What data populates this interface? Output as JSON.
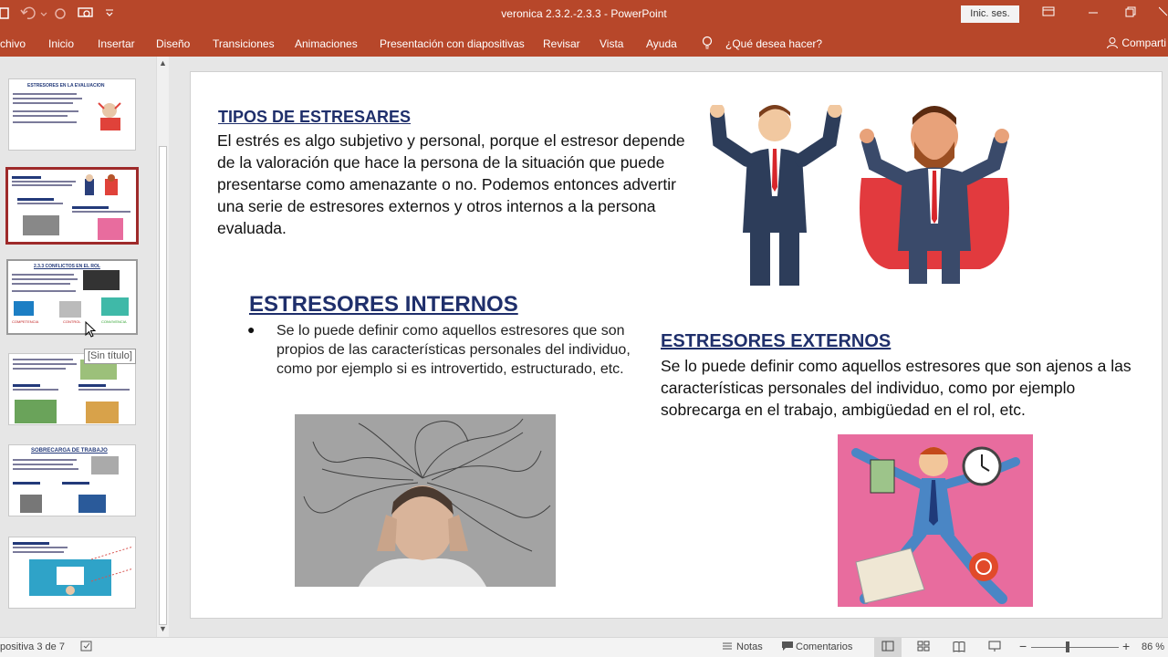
{
  "app": {
    "window_title": "veronica 2.3.2.-2.3.3  -  PowerPoint",
    "sign_in": "Inic. ses."
  },
  "ribbon": {
    "tabs": [
      "chivo",
      "Inicio",
      "Insertar",
      "Diseño",
      "Transiciones",
      "Animaciones",
      "Presentación con diapositivas",
      "Revisar",
      "Vista",
      "Ayuda"
    ],
    "tell_me": "¿Qué desea hacer?",
    "share": "Comparti"
  },
  "thumbnails": {
    "tooltip": "[Sin título]",
    "slide1_title": "ESTRESORES EN LA EVALUACION",
    "slide3_title": "2.3.3 CONFLICTOS EN EL ROL",
    "slide3_labels": [
      "COMPETENCIA",
      "CONTROL",
      "CONVIVENCIA"
    ],
    "slide5_title": "SOBRECARGA DE TRABAJO"
  },
  "slide": {
    "title1": "TIPOS DE ESTRESARES",
    "body1": "El estrés es algo subjetivo y personal, porque el estresor depende de la valoración que hace la persona de la situación que puede presentarse como amenazante o no. Podemos entonces advertir una serie de estresores externos y otros internos a la persona evaluada.",
    "title2": "ESTRESORES INTERNOS",
    "body2": "Se lo puede definir como aquellos estresores que son propios de las características personales del individuo, como por ejemplo si es introvertido, estructurado, etc.",
    "title3": "ESTRESORES EXTERNOS",
    "body3": "Se lo puede definir como aquellos estresores que son ajenos a las características personales del individuo, como por ejemplo sobrecarga en el trabajo, ambigüedad en el rol, etc."
  },
  "status": {
    "slide_counter": "positiva 3 de 7",
    "notes": "Notas",
    "comments": "Comentarios",
    "zoom": "86 %"
  },
  "colors": {
    "accent": "#b7472a",
    "heading": "#1f2f6b",
    "selected_border": "#9e2a2a"
  }
}
